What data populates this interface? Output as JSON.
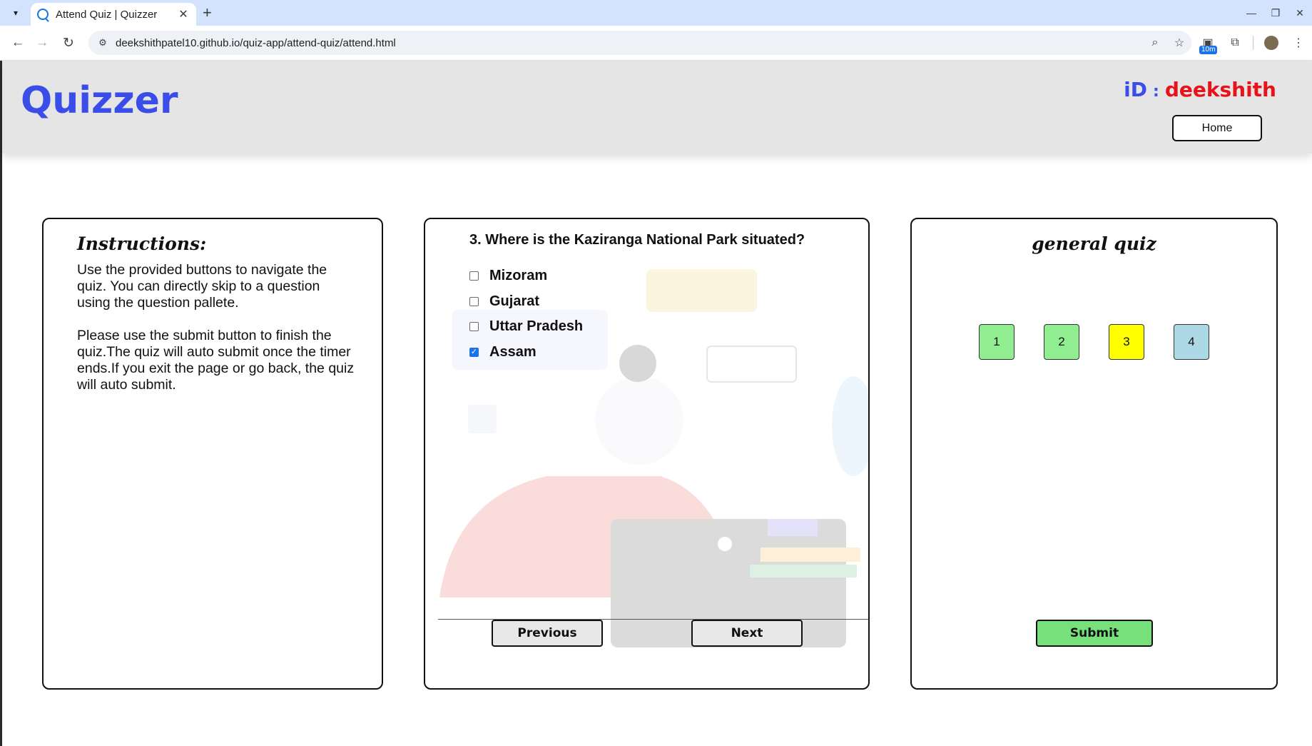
{
  "browser": {
    "tab_title": "Attend Quiz | Quizzer",
    "url": "deekshithpatel10.github.io/quiz-app/attend-quiz/attend.html",
    "extension_badge": "10m",
    "icons": {
      "tab_search": "chevron-down-icon",
      "close": "close-icon",
      "new_tab": "plus-icon"
    }
  },
  "header": {
    "brand": "Quizzer",
    "id_label": "iD",
    "id_separator": ":",
    "username": "deekshith",
    "home_label": "Home",
    "colors": {
      "brand": "#3b4de8",
      "username": "#e8131a",
      "header_bg": "#e5e5e5"
    }
  },
  "instructions": {
    "title": "Instructions:",
    "paragraph1": "Use the provided buttons to navigate the quiz. You can directly skip to a question using the question pallete.",
    "paragraph2": "Please use the submit button to finish the quiz.The quiz will auto submit once the timer ends.If you exit the page or go back, the quiz will auto submit."
  },
  "question": {
    "text": "3. Where is the Kaziranga National Park situated?",
    "options": [
      {
        "label": "Mizoram",
        "checked": false
      },
      {
        "label": "Gujarat",
        "checked": false
      },
      {
        "label": "Uttar Pradesh",
        "checked": false
      },
      {
        "label": "Assam",
        "checked": true
      }
    ],
    "previous_label": "Previous",
    "next_label": "Next"
  },
  "palette": {
    "title": "general quiz",
    "items": [
      {
        "label": "1",
        "color": "#90ee90"
      },
      {
        "label": "2",
        "color": "#90ee90"
      },
      {
        "label": "3",
        "color": "#ffff00"
      },
      {
        "label": "4",
        "color": "#add8e6"
      }
    ],
    "submit_label": "Submit",
    "submit_color": "#77e07a"
  }
}
